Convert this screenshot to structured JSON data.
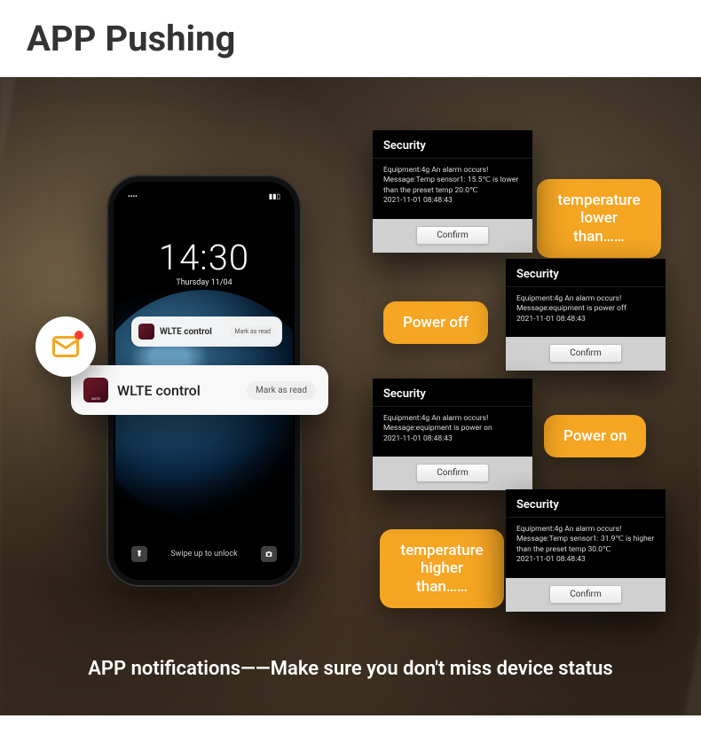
{
  "title": "APP Pushing",
  "caption": "APP notifications——Make sure you don't miss device status",
  "phone": {
    "time": "14:30",
    "date": "Thursday 11/04",
    "swipe": "Swipe up to unlock",
    "signal": "••••",
    "battery": "▮▮▯"
  },
  "notif_small": {
    "app": "WLTE control",
    "action": "Mark as read"
  },
  "notif_large": {
    "app": "WLTE control",
    "action": "Mark as read"
  },
  "tags": {
    "temp_low": "temperature lower than……",
    "power_off": "Power off",
    "power_on": "Power on",
    "temp_high": "temperature higher than……"
  },
  "dialogs": {
    "title": "Security",
    "confirm": "Confirm",
    "timestamp": "2021-11-01 08:48:43",
    "temp_low": {
      "line1": "Equipment:4g An alarm occurs!",
      "line2": "Message:Temp sensor1: 15.5℃ is lower than the preset temp 20.0℃"
    },
    "power_off": {
      "line1": "Equipment:4g An alarm occurs!",
      "line2": "Message:equipment is power off"
    },
    "power_on": {
      "line1": "Equipment:4g An alarm occurs!",
      "line2": "Message:equipment is power on"
    },
    "temp_high": {
      "line1": "Equipment:4g An alarm occurs!",
      "line2": "Message:Temp sensor1: 31.9℃ is higher than the preset temp 30.0℃"
    }
  }
}
